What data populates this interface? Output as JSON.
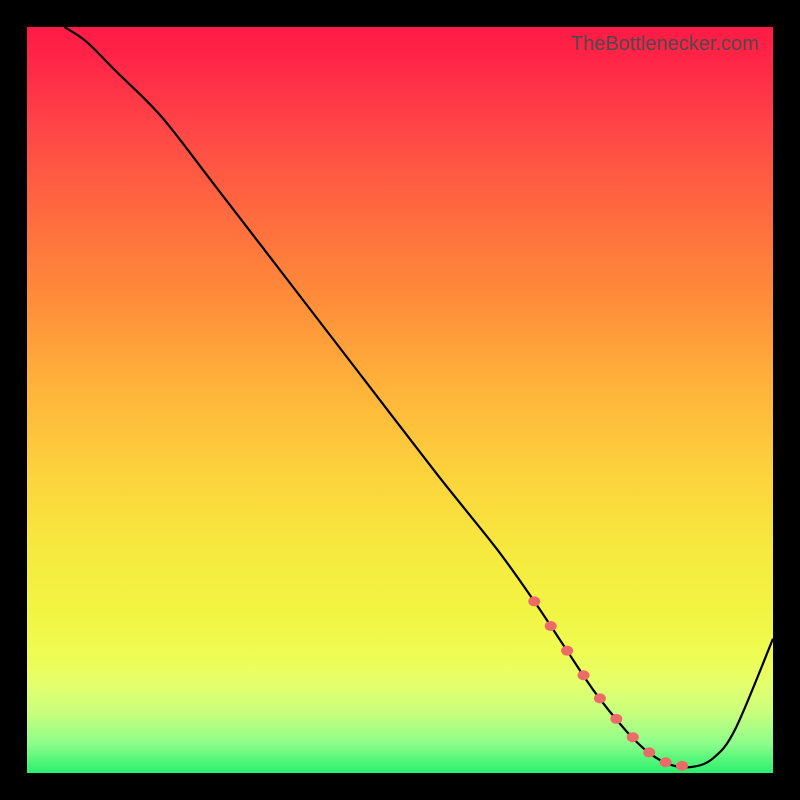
{
  "watermark": "TheBottlenecker.com",
  "chart_data": {
    "type": "line",
    "title": "",
    "xlabel": "",
    "ylabel": "",
    "xlim": [
      0,
      100
    ],
    "ylim": [
      0,
      100
    ],
    "grid": false,
    "series": [
      {
        "name": "curve",
        "x": [
          5,
          8,
          12,
          18,
          25,
          35,
          45,
          55,
          63,
          68,
          72,
          76,
          80,
          83,
          86,
          89,
          92,
          95,
          100
        ],
        "y": [
          100,
          98,
          94,
          88,
          79,
          66,
          53,
          40,
          30,
          23,
          17,
          11,
          6,
          3,
          1.2,
          0.8,
          2,
          6,
          18
        ]
      }
    ],
    "highlight_segment": {
      "x_start": 68,
      "x_end": 90
    },
    "colors": {
      "line": "#000000",
      "marker": "#ec6a67"
    }
  }
}
